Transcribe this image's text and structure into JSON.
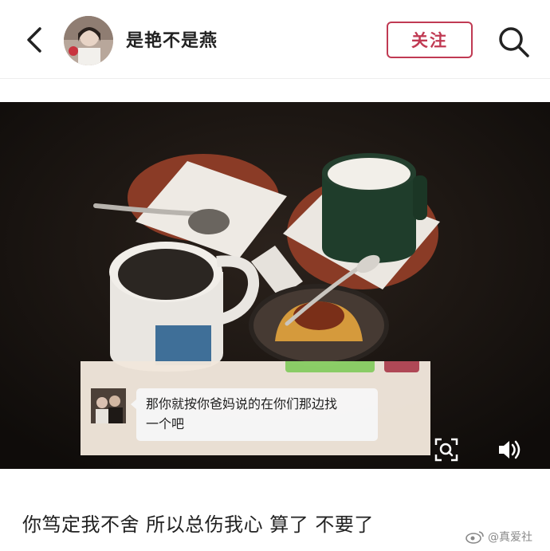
{
  "header": {
    "back_icon": "chevron-left-icon",
    "username": "是艳不是燕",
    "follow_label": "关注",
    "search_icon": "search-icon"
  },
  "post": {
    "chat_message": {
      "line1": "那你就按你爸妈说的在你们那边找",
      "line2": "一个吧"
    },
    "caption": "你笃定我不舍 所以总伤我心 算了 不要了"
  },
  "controls": {
    "scan_icon": "scan-icon",
    "sound_icon": "volume-icon"
  },
  "watermark": {
    "logo": "weibo-icon",
    "text": "@真爱社"
  },
  "colors": {
    "accent": "#c03a53",
    "text": "#222222"
  }
}
